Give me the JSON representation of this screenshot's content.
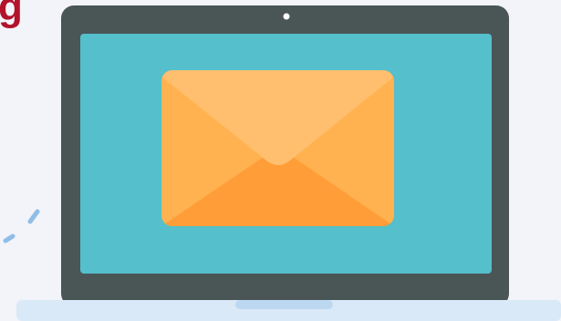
{
  "corner_text": "g",
  "colors": {
    "background": "#f2f4fa",
    "corner_text": "#b3122b",
    "laptop_bezel": "#4a5556",
    "screen": "#55bfcb",
    "camera": "#ffffff",
    "laptop_base": "#d9e9f7",
    "base_notch": "#bcd8f1",
    "envelope_body": "#ffaa47",
    "envelope_flap": "#ffbf6e",
    "envelope_front": "#ff9d38",
    "envelope_side": "#ffb24f",
    "decor_marks": "#8fbde6"
  },
  "icons": {
    "main_illustration": "laptop-icon",
    "screen_content": "envelope-icon"
  }
}
